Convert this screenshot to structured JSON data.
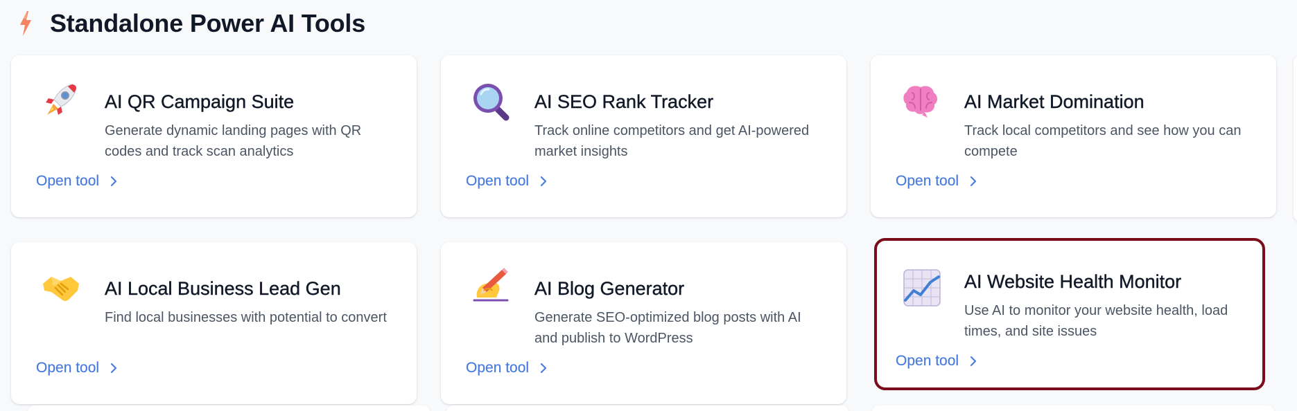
{
  "section": {
    "title": "Standalone Power AI Tools",
    "icon": "lightning-bolt-icon",
    "accent_color": "#f4845f"
  },
  "cards": [
    {
      "title": "AI QR Campaign Suite",
      "description": "Generate dynamic landing pages with QR codes and track scan analytics",
      "icon": "rocket-icon",
      "open_label": "Open tool"
    },
    {
      "title": "AI SEO Rank Tracker",
      "description": "Track online competitors and get AI-powered market insights",
      "icon": "magnifying-glass-icon",
      "open_label": "Open tool"
    },
    {
      "title": "AI Market Domination",
      "description": "Track local competitors and see how you can compete",
      "icon": "brain-icon",
      "open_label": "Open tool"
    },
    {
      "title": "AI Local Business Lead Gen",
      "description": "Find local businesses with potential to convert",
      "icon": "handshake-icon",
      "open_label": "Open tool"
    },
    {
      "title": "AI Blog Generator",
      "description": "Generate SEO-optimized blog posts with AI and publish to WordPress",
      "icon": "writing-hand-icon",
      "open_label": "Open tool"
    },
    {
      "title": "AI Website Health Monitor",
      "description": "Use AI to monitor your website health, load times, and site issues",
      "icon": "chart-increasing-icon",
      "open_label": "Open tool",
      "selected": true
    }
  ],
  "colors": {
    "link": "#4a7cde",
    "selection_outline": "#7a0d1a",
    "background": "#f8f9fb"
  }
}
